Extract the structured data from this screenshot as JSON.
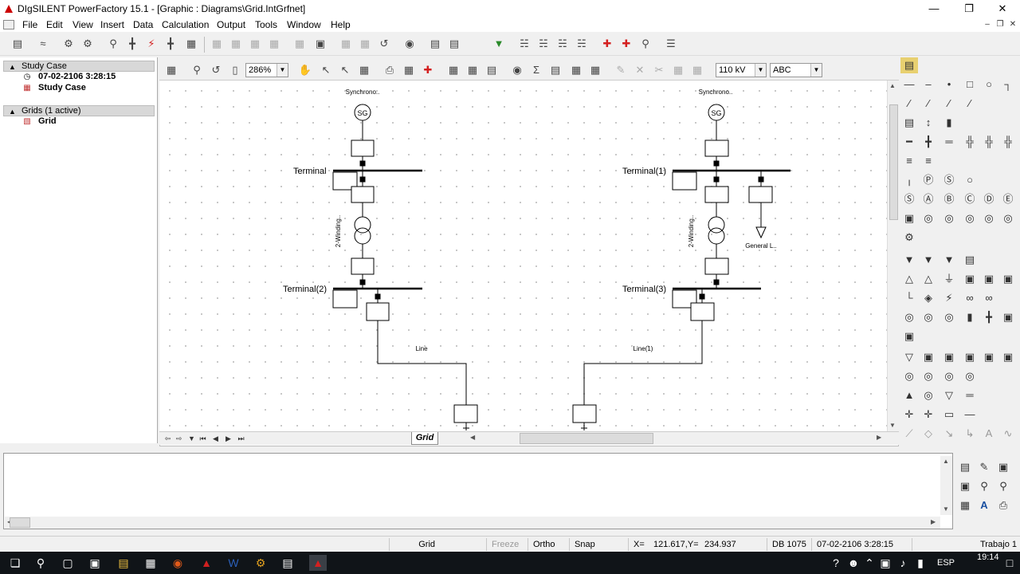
{
  "window": {
    "title": "DIgSILENT PowerFactory 15.1 - [Graphic : Diagrams\\Grid.IntGrfnet]",
    "controls": [
      "minimize-icon",
      "restore-icon",
      "close-icon"
    ]
  },
  "menu": [
    "File",
    "Edit",
    "View",
    "Insert",
    "Data",
    "Calculation",
    "Output",
    "Tools",
    "Window",
    "Help"
  ],
  "left_panel": {
    "study_case_group": "Study Case",
    "study_case_date": "07-02-2106 3:28:15",
    "study_case_name": "Study Case",
    "grids_group": "Grids (1 active)",
    "grid_name": "Grid"
  },
  "graphic_toolbar": {
    "zoom": "286%",
    "voltage": "110 kV",
    "label_mode": "ABC"
  },
  "diagram": {
    "left": {
      "gen_label": "Synchrono..",
      "gen_symbol": "SG",
      "bus1": "Terminal",
      "trafo": "2-Winding..",
      "bus2": "Terminal(2)",
      "line": "Line"
    },
    "right": {
      "gen_label": "Synchrono..",
      "gen_symbol": "SG",
      "bus1": "Terminal(1)",
      "trafo": "2-Winding..",
      "bus2": "Terminal(3)",
      "line": "Line(1)",
      "load": "General L.."
    }
  },
  "sheet_tab": "Grid",
  "status_bar": {
    "grid": "Grid",
    "freeze": "Freeze",
    "ortho": "Ortho",
    "snap": "Snap",
    "x_label": "X=",
    "coords": "121.617,Y=",
    "y_value": "234.937",
    "db": "DB 1075",
    "timestamp": "07-02-2106 3:28:15",
    "work": "Trabajo 1"
  },
  "taskbar": {
    "lang": "ESP",
    "time": "19:14"
  },
  "colors": {
    "canvas_bg": "#ffffff",
    "grid_dot": "#bdbdbd",
    "taskbar": "#101418",
    "red_tool": "#d42020"
  }
}
